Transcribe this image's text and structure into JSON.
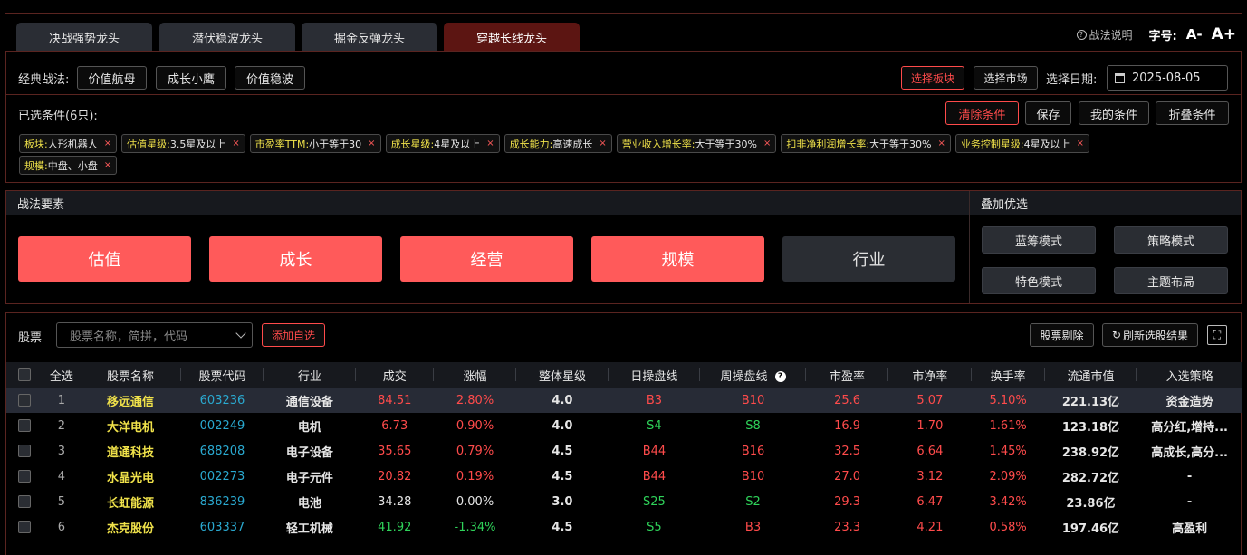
{
  "tabs": [
    "决战强势龙头",
    "潜伏稳波龙头",
    "掘金反弹龙头",
    "穿越长线龙头"
  ],
  "active_tab": 3,
  "top_right": {
    "help_label": "战法说明",
    "font_label": "字号:",
    "font_small": "A-",
    "font_big": "A+"
  },
  "classic": {
    "label": "经典战法:",
    "buttons": [
      "价值航母",
      "成长小鹰",
      "价值稳波"
    ],
    "select_sector": "选择板块",
    "select_market": "选择市场",
    "date_label": "选择日期:",
    "date_value": "2025-08-05"
  },
  "conditions": {
    "label": "已选条件(6只):",
    "clear": "清除条件",
    "save": "保存",
    "mine": "我的条件",
    "fold": "折叠条件",
    "chips": [
      {
        "k": "板块:",
        "v": "人形机器人"
      },
      {
        "k": "估值星级:",
        "v": "3.5星及以上"
      },
      {
        "k": "市盈率TTM:",
        "v": "小于等于30"
      },
      {
        "k": "成长星级:",
        "v": "4星及以上"
      },
      {
        "k": "成长能力:",
        "v": "高速成长"
      },
      {
        "k": "营业收入增长率:",
        "v": "大于等于30%"
      },
      {
        "k": "扣非净利润增长率:",
        "v": "大于等于30%"
      },
      {
        "k": "业务控制星级:",
        "v": "4星及以上"
      },
      {
        "k": "规模:",
        "v": "中盘、小盘"
      }
    ],
    "chip_close": "×"
  },
  "strategy": {
    "title": "战法要素",
    "elements": [
      {
        "label": "估值",
        "active": true
      },
      {
        "label": "成长",
        "active": true
      },
      {
        "label": "经营",
        "active": true
      },
      {
        "label": "规模",
        "active": true
      },
      {
        "label": "行业",
        "active": false
      }
    ],
    "overlay_title": "叠加优选",
    "overlay_buttons": [
      "蓝筹模式",
      "策略模式",
      "特色模式",
      "主题布局"
    ]
  },
  "stocks": {
    "label": "股票",
    "search_placeholder": "股票名称，简拼，代码",
    "add_watch": "添加自选",
    "remove": "股票剔除",
    "refresh": "刷新选股结果",
    "columns": [
      "全选",
      "股票名称",
      "股票代码",
      "行业",
      "成交",
      "涨幅",
      "整体星级",
      "日操盘线",
      "周操盘线",
      "市盈率",
      "市净率",
      "换手率",
      "流通市值",
      "入选策略"
    ],
    "rows": [
      {
        "idx": "1",
        "name": "移远通信",
        "code": "603236",
        "industry": "通信设备",
        "price": "84.51",
        "change": "2.80%",
        "dir": "up",
        "star": "4.0",
        "day": "B3",
        "day_dir": "up",
        "week": "B10",
        "week_dir": "up",
        "pe": "25.6",
        "pb": "5.07",
        "turnover": "5.10%",
        "mcap": "221.13亿",
        "strategy": "资金造势"
      },
      {
        "idx": "2",
        "name": "大洋电机",
        "code": "002249",
        "industry": "电机",
        "price": "6.73",
        "change": "0.90%",
        "dir": "up",
        "star": "4.0",
        "day": "S4",
        "day_dir": "dn",
        "week": "S8",
        "week_dir": "dn",
        "pe": "16.9",
        "pb": "1.70",
        "turnover": "1.61%",
        "mcap": "123.18亿",
        "strategy": "高分红,增持..."
      },
      {
        "idx": "3",
        "name": "道通科技",
        "code": "688208",
        "industry": "电子设备",
        "price": "35.65",
        "change": "0.79%",
        "dir": "up",
        "star": "4.5",
        "day": "B44",
        "day_dir": "up",
        "week": "B16",
        "week_dir": "up",
        "pe": "32.5",
        "pb": "6.64",
        "turnover": "1.45%",
        "mcap": "238.92亿",
        "strategy": "高成长,高分..."
      },
      {
        "idx": "4",
        "name": "水晶光电",
        "code": "002273",
        "industry": "电子元件",
        "price": "20.82",
        "change": "0.19%",
        "dir": "up",
        "star": "4.5",
        "day": "B44",
        "day_dir": "up",
        "week": "B10",
        "week_dir": "up",
        "pe": "27.0",
        "pb": "3.12",
        "turnover": "2.09%",
        "mcap": "282.72亿",
        "strategy": "-"
      },
      {
        "idx": "5",
        "name": "长虹能源",
        "code": "836239",
        "industry": "电池",
        "price": "34.28",
        "change": "0.00%",
        "dir": "flat",
        "star": "3.0",
        "day": "S25",
        "day_dir": "dn",
        "week": "S2",
        "week_dir": "dn",
        "pe": "29.3",
        "pb": "6.47",
        "turnover": "3.42%",
        "mcap": "23.86亿",
        "strategy": "-"
      },
      {
        "idx": "6",
        "name": "杰克股份",
        "code": "603337",
        "industry": "轻工机械",
        "price": "41.92",
        "change": "-1.34%",
        "dir": "dn",
        "star": "4.5",
        "day": "S5",
        "day_dir": "dn",
        "week": "B3",
        "week_dir": "up",
        "pe": "23.3",
        "pb": "4.21",
        "turnover": "0.58%",
        "mcap": "197.46亿",
        "strategy": "高盈利"
      }
    ]
  }
}
